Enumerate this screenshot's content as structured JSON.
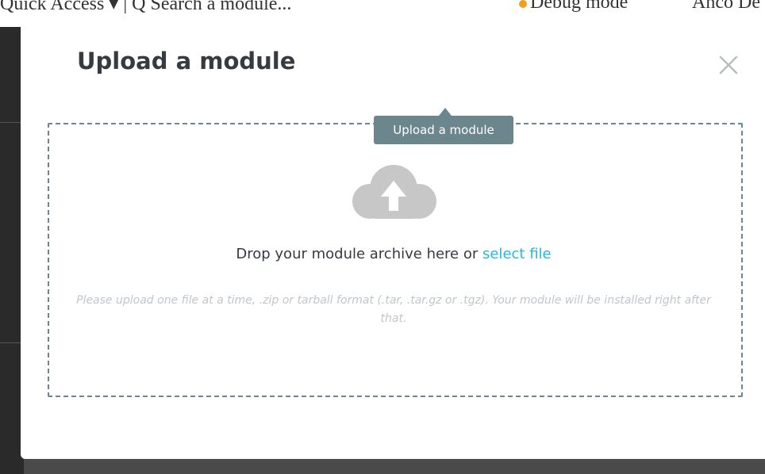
{
  "underlay": {
    "quick_access": "Quick Access ▾  |  Q  Search a module...",
    "debug_mode": "Debug mode",
    "user": "Anco De"
  },
  "modal": {
    "title": "Upload a module",
    "close_icon": "close-icon",
    "tooltip": "Upload a module",
    "drop_text": "Drop your module archive here or ",
    "select_file": "select file",
    "help_text": "Please upload one file at a time, .zip or tarball format (.tar, .tar.gz or .tgz). Your module will be installed right after that.",
    "upload_icon": "cloud-upload-icon"
  },
  "colors": {
    "accent": "#25b9d7",
    "border": "#6c868e",
    "title": "#363a41",
    "help": "#c0c6ca",
    "icon": "#c7c7c7"
  }
}
